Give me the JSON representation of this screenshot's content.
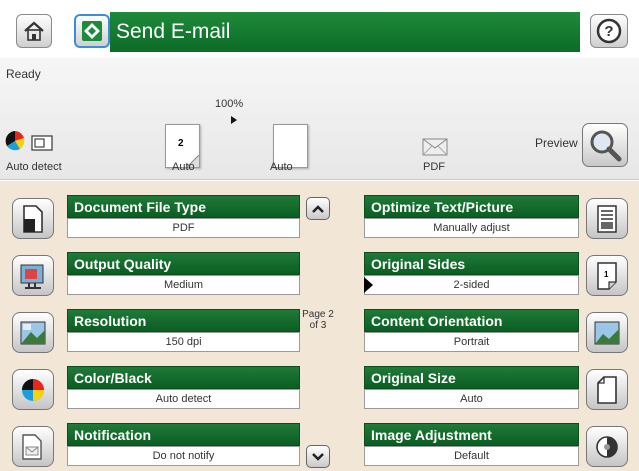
{
  "header": {
    "title": "Send E-mail",
    "icons": {
      "home": "home-icon",
      "start": "start-icon",
      "help": "help-icon"
    },
    "colors": {
      "title_bar": "#1a7f35",
      "start_border": "#3a8fd8"
    }
  },
  "status": {
    "state": "Ready",
    "zoom": "100%",
    "color_mode_label": "Auto detect",
    "page1_number": "2",
    "page1_label": "Auto",
    "page2_label": "Auto",
    "format_label": "PDF",
    "preview_label": "Preview"
  },
  "options": {
    "left": [
      {
        "title": "Document File Type",
        "value": "PDF",
        "icon": "document-file-icon"
      },
      {
        "title": "Output Quality",
        "value": "Medium",
        "icon": "output-quality-icon"
      },
      {
        "title": "Resolution",
        "value": "150 dpi",
        "icon": "resolution-icon"
      },
      {
        "title": "Color/Black",
        "value": "Auto detect",
        "icon": "color-black-icon"
      },
      {
        "title": "Notification",
        "value": "Do not notify",
        "icon": "notification-icon"
      }
    ],
    "right": [
      {
        "title": "Optimize Text/Picture",
        "value": "Manually adjust",
        "icon": "optimize-text-picture-icon"
      },
      {
        "title": "Original Sides",
        "value": "2-sided",
        "icon": "original-sides-icon"
      },
      {
        "title": "Content Orientation",
        "value": "Portrait",
        "icon": "content-orientation-icon"
      },
      {
        "title": "Original Size",
        "value": "Auto",
        "icon": "original-size-icon"
      },
      {
        "title": "Image Adjustment",
        "value": "Default",
        "icon": "image-adjustment-icon"
      }
    ],
    "page_indicator": {
      "line1": "Page 2",
      "line2": "of 3"
    }
  }
}
